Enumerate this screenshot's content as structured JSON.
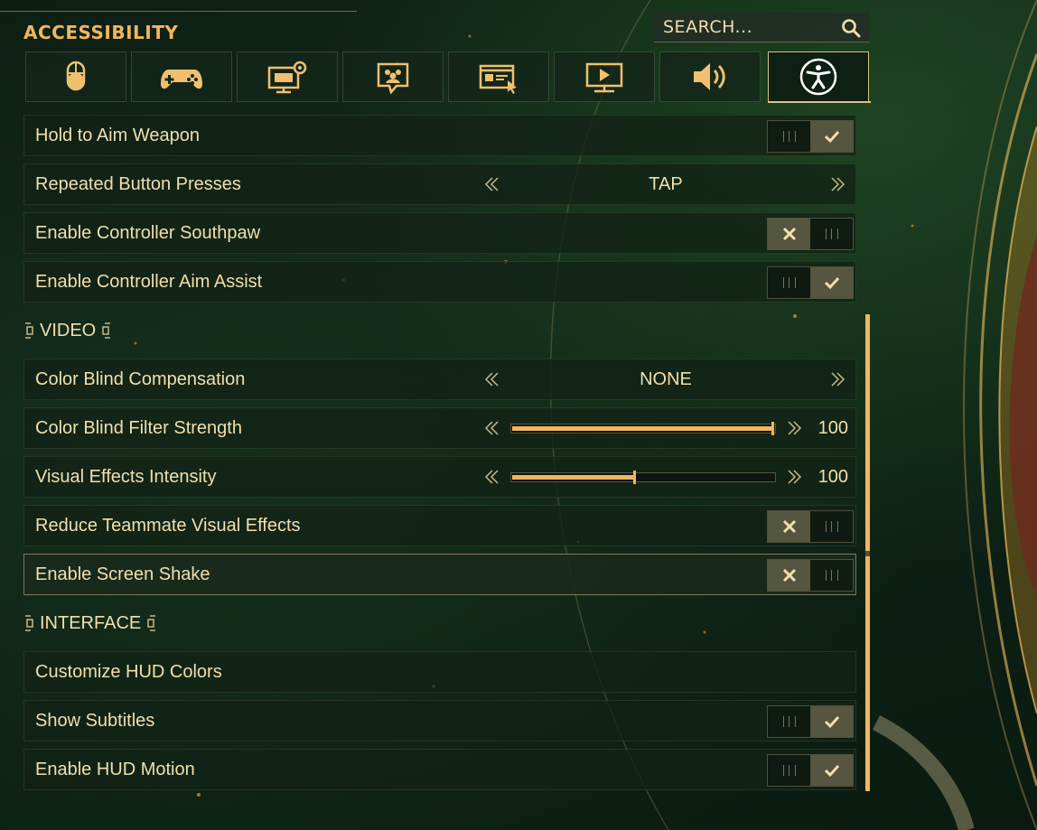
{
  "header": {
    "title": "ACCESSIBILITY",
    "search_placeholder": "SEARCH..."
  },
  "tabs": [
    {
      "icon": "mouse-icon",
      "active": false
    },
    {
      "icon": "gamepad-icon",
      "active": false
    },
    {
      "icon": "display-settings-icon",
      "active": false
    },
    {
      "icon": "social-chat-icon",
      "active": false
    },
    {
      "icon": "interface-cursor-icon",
      "active": false
    },
    {
      "icon": "video-play-icon",
      "active": false
    },
    {
      "icon": "speaker-icon",
      "active": false
    },
    {
      "icon": "accessibility-icon",
      "active": true
    }
  ],
  "rows": {
    "hold_to_aim": {
      "label": "Hold to Aim Weapon",
      "enabled": true
    },
    "repeated_presses": {
      "label": "Repeated Button Presses",
      "value": "TAP"
    },
    "southpaw": {
      "label": "Enable Controller Southpaw",
      "enabled": false
    },
    "aim_assist": {
      "label": "Enable Controller Aim Assist",
      "enabled": true
    },
    "color_blind_comp": {
      "label": "Color Blind Compensation",
      "value": "NONE"
    },
    "color_blind_strength": {
      "label": "Color Blind Filter Strength",
      "value": "100",
      "fill_fraction": 1.0
    },
    "visual_effects": {
      "label": "Visual Effects Intensity",
      "value": "100",
      "fill_fraction": 0.47
    },
    "reduce_teammate": {
      "label": "Reduce Teammate Visual Effects",
      "enabled": false
    },
    "screen_shake": {
      "label": "Enable Screen Shake",
      "enabled": false
    },
    "customize_hud": {
      "label": "Customize HUD Colors"
    },
    "subtitles": {
      "label": "Show Subtitles",
      "enabled": true
    },
    "hud_motion": {
      "label": "Enable HUD Motion",
      "enabled": true
    }
  },
  "sections": {
    "video": "VIDEO",
    "interface": "INTERFACE"
  },
  "colors": {
    "accent": "#f0b660",
    "text": "#f2dfae",
    "background": "#0e2216"
  }
}
